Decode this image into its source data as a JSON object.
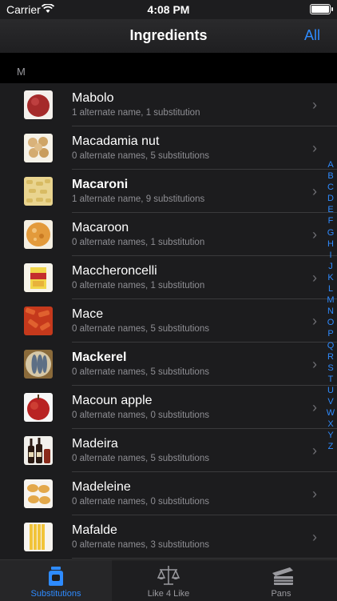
{
  "status": {
    "carrier": "Carrier",
    "time": "4:08 PM"
  },
  "nav": {
    "title": "Ingredients",
    "right_button": "All"
  },
  "section": "M",
  "items": [
    {
      "name": "Mabolo",
      "detail": "1 alternate name, 1 substitution",
      "bold": false,
      "icon": "fruit-thumbnail"
    },
    {
      "name": "Macadamia nut",
      "detail": "0 alternate names, 5 substitutions",
      "bold": false,
      "icon": "nut-thumbnail"
    },
    {
      "name": "Macaroni",
      "detail": "1 alternate name, 9 substitutions",
      "bold": true,
      "icon": "pasta-thumbnail"
    },
    {
      "name": "Macaroon",
      "detail": "0 alternate names, 1 substitution",
      "bold": false,
      "icon": "cookie-thumbnail"
    },
    {
      "name": "Maccheroncelli",
      "detail": "0 alternate names, 1 substitution",
      "bold": false,
      "icon": "pasta-package-thumbnail"
    },
    {
      "name": "Mace",
      "detail": "0 alternate names, 5 substitutions",
      "bold": false,
      "icon": "spice-thumbnail"
    },
    {
      "name": "Mackerel",
      "detail": "0 alternate names, 5 substitutions",
      "bold": true,
      "icon": "fish-thumbnail"
    },
    {
      "name": "Macoun apple",
      "detail": "0 alternate names, 0 substitutions",
      "bold": false,
      "icon": "apple-thumbnail"
    },
    {
      "name": "Madeira",
      "detail": "0 alternate names, 5 substitutions",
      "bold": false,
      "icon": "wine-bottles-thumbnail"
    },
    {
      "name": "Madeleine",
      "detail": "0 alternate names, 0 substitutions",
      "bold": false,
      "icon": "cake-thumbnail"
    },
    {
      "name": "Mafalde",
      "detail": "0 alternate names, 3 substitutions",
      "bold": false,
      "icon": "pasta-ribbon-thumbnail"
    }
  ],
  "index_letters": [
    "A",
    "B",
    "C",
    "D",
    "E",
    "F",
    "G",
    "H",
    "I",
    "J",
    "K",
    "L",
    "M",
    "N",
    "O",
    "P",
    "Q",
    "R",
    "S",
    "T",
    "U",
    "V",
    "W",
    "X",
    "Y",
    "Z"
  ],
  "tabs": [
    {
      "label": "Substitutions",
      "icon": "jar-icon",
      "active": true
    },
    {
      "label": "Like 4 Like",
      "icon": "scale-icon",
      "active": false
    },
    {
      "label": "Pans",
      "icon": "pans-icon",
      "active": false
    }
  ],
  "colors": {
    "accent": "#2e8bff",
    "background": "#1c1c1e",
    "secondary_text": "#8e8e93"
  }
}
